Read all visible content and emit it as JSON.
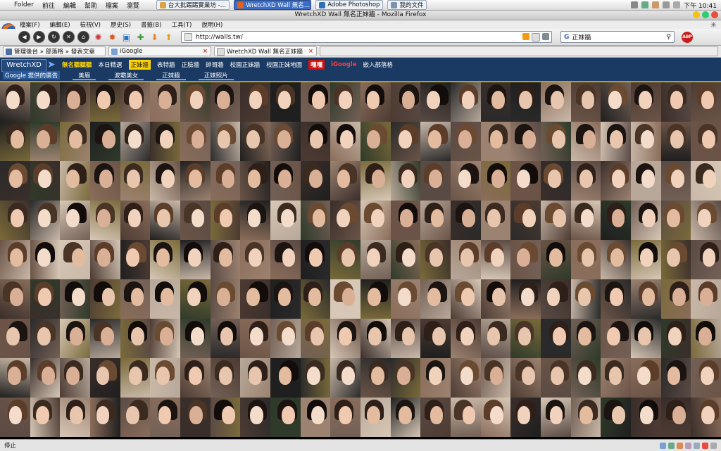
{
  "os_menubar": {
    "items": [
      "Folder",
      "前往",
      "編輯",
      "幫助",
      "檔案",
      "瀏覽"
    ],
    "tasks": [
      {
        "label": "台大批踢踢實業坊 -…",
        "active": false,
        "color": "#d9a441"
      },
      {
        "label": "WretchXD Wall 無名…",
        "active": true,
        "color": "#e0601c"
      },
      {
        "label": "Adobe Photoshop",
        "active": false,
        "color": "#2f6fb8"
      },
      {
        "label": "我的文件",
        "active": false,
        "color": "#7e92ad"
      }
    ],
    "clock": "下午 10:41"
  },
  "window": {
    "title": "WretchXD Wall 無名正妹牆 - Mozilla Firefox"
  },
  "ff_menu": [
    "檔案(F)",
    "編輯(E)",
    "檢視(V)",
    "歷史(S)",
    "書籤(B)",
    "工具(T)",
    "說明(H)"
  ],
  "navbar": {
    "url": "http://walls.tw/",
    "search_value": "正妹牆",
    "search_engine": "G",
    "adblock_label": "ABP"
  },
  "bookmarks": [
    {
      "label": "管理後台 » 部落格 » 發表文章",
      "closable": false
    },
    {
      "label": "iGoogle",
      "closable": true
    },
    {
      "label": "WretchXD Wall 無名正妹牆",
      "closable": true
    }
  ],
  "site": {
    "logo": "WretchXD",
    "links": [
      {
        "label": "無名聽聽聽",
        "style": "hot"
      },
      {
        "label": "本日精選",
        "style": ""
      },
      {
        "label": "正妹牆",
        "style": "sel"
      },
      {
        "label": "表特牆",
        "style": ""
      },
      {
        "label": "正臉牆",
        "style": ""
      },
      {
        "label": "帥哥牆",
        "style": ""
      },
      {
        "label": "校園正妹牆",
        "style": ""
      },
      {
        "label": "校園正妹地圖",
        "style": ""
      },
      {
        "label": "嘿嘿",
        "style": "red"
      },
      {
        "label": "iGoogle",
        "style": "redtxt"
      },
      {
        "label": "嵌入部落格",
        "style": ""
      }
    ],
    "sub_ads": "Google 提供的廣告",
    "sub_links": [
      "美眉",
      "波霸美女",
      "正妹牆",
      "正妹照片"
    ]
  },
  "status": {
    "text": "停止"
  },
  "colors": {
    "site_nav_bg": "#1a3a63",
    "highlight_yellow": "#ffd400",
    "active_task": "#3d6cc5"
  },
  "photo_wall": {
    "rows": 9,
    "cols": 24
  }
}
